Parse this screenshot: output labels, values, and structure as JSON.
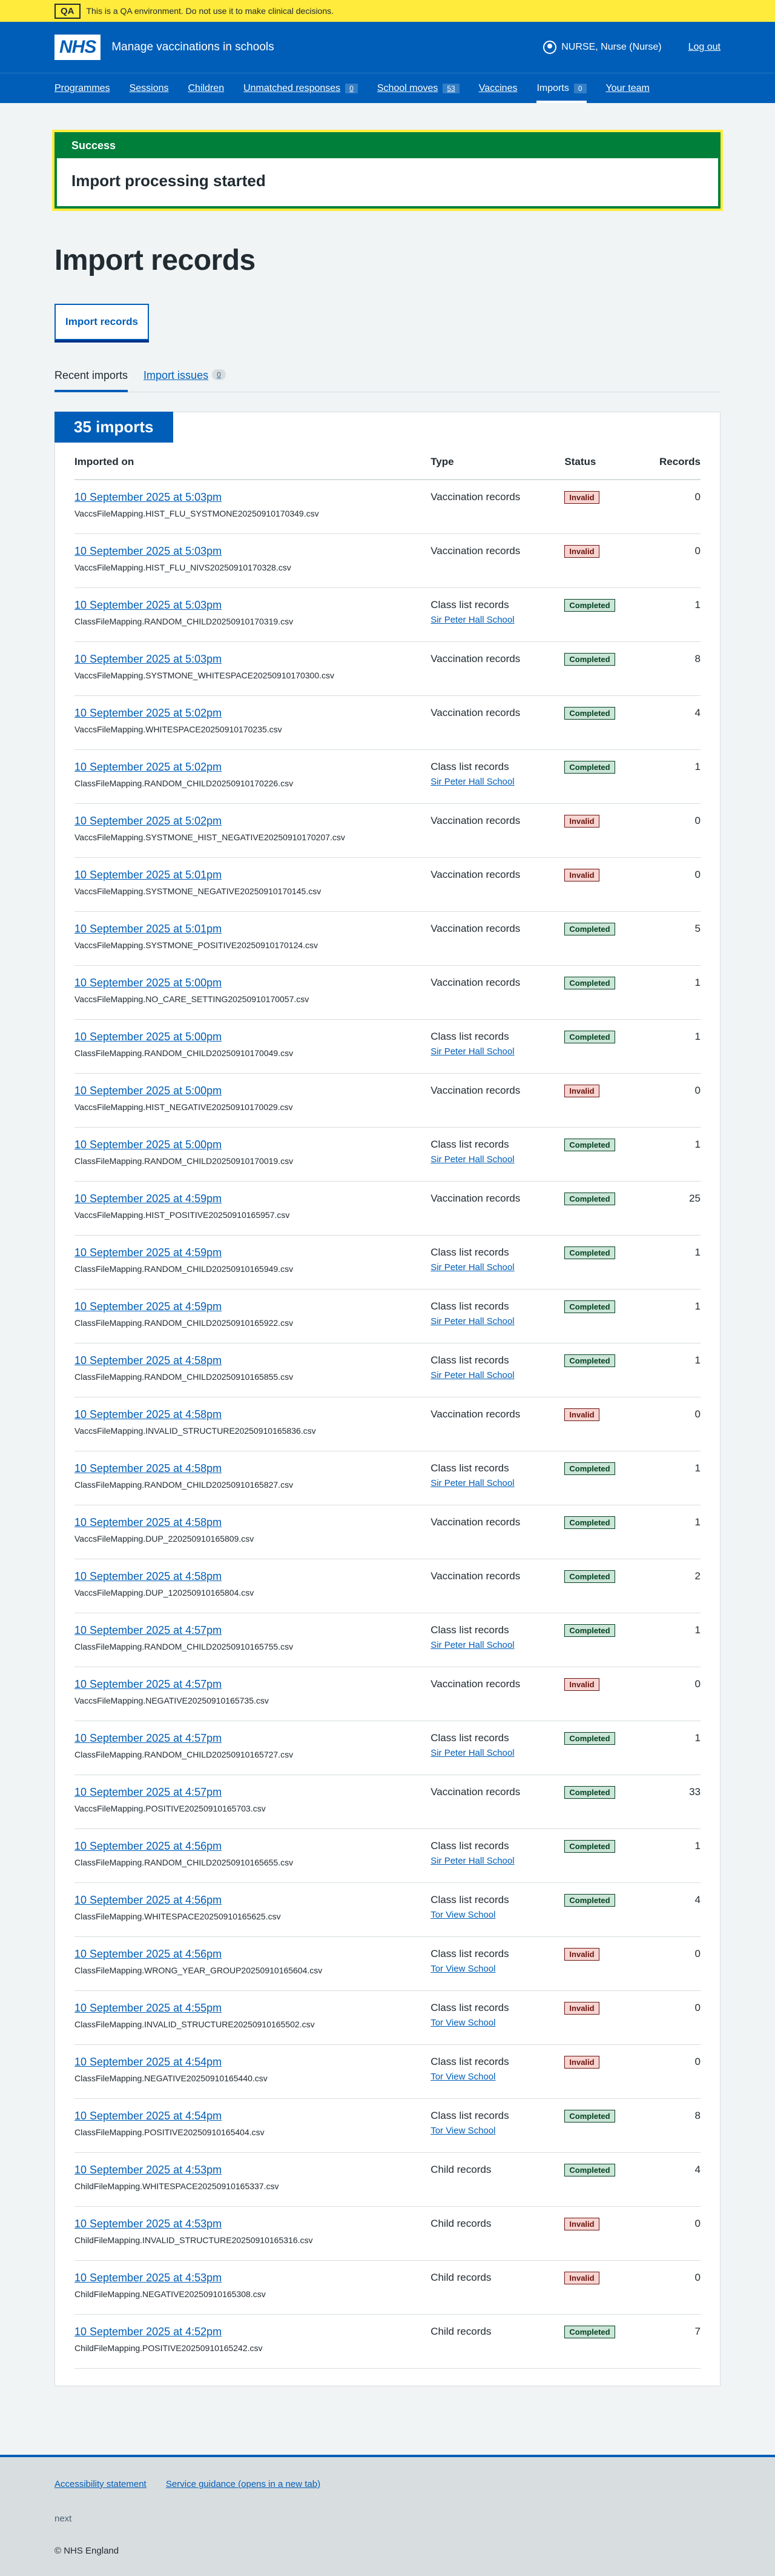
{
  "env": {
    "tag": "QA",
    "message": "This is a QA environment. Do not use it to make clinical decisions."
  },
  "header": {
    "logo": "NHS",
    "service": "Manage vaccinations in schools",
    "user": "NURSE, Nurse (Nurse)",
    "logout": "Log out",
    "nav": [
      {
        "label": "Programmes"
      },
      {
        "label": "Sessions"
      },
      {
        "label": "Children"
      },
      {
        "label": "Unmatched responses",
        "count": "0"
      },
      {
        "label": "School moves",
        "count": "53"
      },
      {
        "label": "Vaccines"
      },
      {
        "label": "Imports",
        "count": "0",
        "active": true
      },
      {
        "label": "Your team"
      }
    ]
  },
  "banner": {
    "title": "Success",
    "message": "Import processing started"
  },
  "page": {
    "title": "Import records",
    "button": "Import records"
  },
  "tabs": {
    "recent": "Recent imports",
    "issues": "Import issues",
    "issues_count": "0"
  },
  "table": {
    "heading": "35 imports",
    "columns": {
      "imported_on": "Imported on",
      "type": "Type",
      "status": "Status",
      "records": "Records"
    },
    "rows": [
      {
        "date": "10 September 2025 at 5:03pm",
        "file": "VaccsFileMapping.HIST_FLU_SYSTMONE20250910170349.csv",
        "type": "Vaccination records",
        "school": "",
        "status": "Invalid",
        "records": "0"
      },
      {
        "date": "10 September 2025 at 5:03pm",
        "file": "VaccsFileMapping.HIST_FLU_NIVS20250910170328.csv",
        "type": "Vaccination records",
        "school": "",
        "status": "Invalid",
        "records": "0"
      },
      {
        "date": "10 September 2025 at 5:03pm",
        "file": "ClassFileMapping.RANDOM_CHILD20250910170319.csv",
        "type": "Class list records",
        "school": "Sir Peter Hall School",
        "status": "Completed",
        "records": "1"
      },
      {
        "date": "10 September 2025 at 5:03pm",
        "file": "VaccsFileMapping.SYSTMONE_WHITESPACE20250910170300.csv",
        "type": "Vaccination records",
        "school": "",
        "status": "Completed",
        "records": "8"
      },
      {
        "date": "10 September 2025 at 5:02pm",
        "file": "VaccsFileMapping.WHITESPACE20250910170235.csv",
        "type": "Vaccination records",
        "school": "",
        "status": "Completed",
        "records": "4"
      },
      {
        "date": "10 September 2025 at 5:02pm",
        "file": "ClassFileMapping.RANDOM_CHILD20250910170226.csv",
        "type": "Class list records",
        "school": "Sir Peter Hall School",
        "status": "Completed",
        "records": "1"
      },
      {
        "date": "10 September 2025 at 5:02pm",
        "file": "VaccsFileMapping.SYSTMONE_HIST_NEGATIVE20250910170207.csv",
        "type": "Vaccination records",
        "school": "",
        "status": "Invalid",
        "records": "0"
      },
      {
        "date": "10 September 2025 at 5:01pm",
        "file": "VaccsFileMapping.SYSTMONE_NEGATIVE20250910170145.csv",
        "type": "Vaccination records",
        "school": "",
        "status": "Invalid",
        "records": "0"
      },
      {
        "date": "10 September 2025 at 5:01pm",
        "file": "VaccsFileMapping.SYSTMONE_POSITIVE20250910170124.csv",
        "type": "Vaccination records",
        "school": "",
        "status": "Completed",
        "records": "5"
      },
      {
        "date": "10 September 2025 at 5:00pm",
        "file": "VaccsFileMapping.NO_CARE_SETTING20250910170057.csv",
        "type": "Vaccination records",
        "school": "",
        "status": "Completed",
        "records": "1"
      },
      {
        "date": "10 September 2025 at 5:00pm",
        "file": "ClassFileMapping.RANDOM_CHILD20250910170049.csv",
        "type": "Class list records",
        "school": "Sir Peter Hall School",
        "status": "Completed",
        "records": "1"
      },
      {
        "date": "10 September 2025 at 5:00pm",
        "file": "VaccsFileMapping.HIST_NEGATIVE20250910170029.csv",
        "type": "Vaccination records",
        "school": "",
        "status": "Invalid",
        "records": "0"
      },
      {
        "date": "10 September 2025 at 5:00pm",
        "file": "ClassFileMapping.RANDOM_CHILD20250910170019.csv",
        "type": "Class list records",
        "school": "Sir Peter Hall School",
        "status": "Completed",
        "records": "1"
      },
      {
        "date": "10 September 2025 at 4:59pm",
        "file": "VaccsFileMapping.HIST_POSITIVE20250910165957.csv",
        "type": "Vaccination records",
        "school": "",
        "status": "Completed",
        "records": "25"
      },
      {
        "date": "10 September 2025 at 4:59pm",
        "file": "ClassFileMapping.RANDOM_CHILD20250910165949.csv",
        "type": "Class list records",
        "school": "Sir Peter Hall School",
        "status": "Completed",
        "records": "1"
      },
      {
        "date": "10 September 2025 at 4:59pm",
        "file": "ClassFileMapping.RANDOM_CHILD20250910165922.csv",
        "type": "Class list records",
        "school": "Sir Peter Hall School",
        "status": "Completed",
        "records": "1"
      },
      {
        "date": "10 September 2025 at 4:58pm",
        "file": "ClassFileMapping.RANDOM_CHILD20250910165855.csv",
        "type": "Class list records",
        "school": "Sir Peter Hall School",
        "status": "Completed",
        "records": "1"
      },
      {
        "date": "10 September 2025 at 4:58pm",
        "file": "VaccsFileMapping.INVALID_STRUCTURE20250910165836.csv",
        "type": "Vaccination records",
        "school": "",
        "status": "Invalid",
        "records": "0"
      },
      {
        "date": "10 September 2025 at 4:58pm",
        "file": "ClassFileMapping.RANDOM_CHILD20250910165827.csv",
        "type": "Class list records",
        "school": "Sir Peter Hall School",
        "status": "Completed",
        "records": "1"
      },
      {
        "date": "10 September 2025 at 4:58pm",
        "file": "VaccsFileMapping.DUP_220250910165809.csv",
        "type": "Vaccination records",
        "school": "",
        "status": "Completed",
        "records": "1"
      },
      {
        "date": "10 September 2025 at 4:58pm",
        "file": "VaccsFileMapping.DUP_120250910165804.csv",
        "type": "Vaccination records",
        "school": "",
        "status": "Completed",
        "records": "2"
      },
      {
        "date": "10 September 2025 at 4:57pm",
        "file": "ClassFileMapping.RANDOM_CHILD20250910165755.csv",
        "type": "Class list records",
        "school": "Sir Peter Hall School",
        "status": "Completed",
        "records": "1"
      },
      {
        "date": "10 September 2025 at 4:57pm",
        "file": "VaccsFileMapping.NEGATIVE20250910165735.csv",
        "type": "Vaccination records",
        "school": "",
        "status": "Invalid",
        "records": "0"
      },
      {
        "date": "10 September 2025 at 4:57pm",
        "file": "ClassFileMapping.RANDOM_CHILD20250910165727.csv",
        "type": "Class list records",
        "school": "Sir Peter Hall School",
        "status": "Completed",
        "records": "1"
      },
      {
        "date": "10 September 2025 at 4:57pm",
        "file": "VaccsFileMapping.POSITIVE20250910165703.csv",
        "type": "Vaccination records",
        "school": "",
        "status": "Completed",
        "records": "33"
      },
      {
        "date": "10 September 2025 at 4:56pm",
        "file": "ClassFileMapping.RANDOM_CHILD20250910165655.csv",
        "type": "Class list records",
        "school": "Sir Peter Hall School",
        "status": "Completed",
        "records": "1"
      },
      {
        "date": "10 September 2025 at 4:56pm",
        "file": "ClassFileMapping.WHITESPACE20250910165625.csv",
        "type": "Class list records",
        "school": "Tor View School",
        "status": "Completed",
        "records": "4"
      },
      {
        "date": "10 September 2025 at 4:56pm",
        "file": "ClassFileMapping.WRONG_YEAR_GROUP20250910165604.csv",
        "type": "Class list records",
        "school": "Tor View School",
        "status": "Invalid",
        "records": "0"
      },
      {
        "date": "10 September 2025 at 4:55pm",
        "file": "ClassFileMapping.INVALID_STRUCTURE20250910165502.csv",
        "type": "Class list records",
        "school": "Tor View School",
        "status": "Invalid",
        "records": "0"
      },
      {
        "date": "10 September 2025 at 4:54pm",
        "file": "ClassFileMapping.NEGATIVE20250910165440.csv",
        "type": "Class list records",
        "school": "Tor View School",
        "status": "Invalid",
        "records": "0"
      },
      {
        "date": "10 September 2025 at 4:54pm",
        "file": "ClassFileMapping.POSITIVE20250910165404.csv",
        "type": "Class list records",
        "school": "Tor View School",
        "status": "Completed",
        "records": "8"
      },
      {
        "date": "10 September 2025 at 4:53pm",
        "file": "ChildFileMapping.WHITESPACE20250910165337.csv",
        "type": "Child records",
        "school": "",
        "status": "Completed",
        "records": "4"
      },
      {
        "date": "10 September 2025 at 4:53pm",
        "file": "ChildFileMapping.INVALID_STRUCTURE20250910165316.csv",
        "type": "Child records",
        "school": "",
        "status": "Invalid",
        "records": "0"
      },
      {
        "date": "10 September 2025 at 4:53pm",
        "file": "ChildFileMapping.NEGATIVE20250910165308.csv",
        "type": "Child records",
        "school": "",
        "status": "Invalid",
        "records": "0"
      },
      {
        "date": "10 September 2025 at 4:52pm",
        "file": "ChildFileMapping.POSITIVE20250910165242.csv",
        "type": "Child records",
        "school": "",
        "status": "Completed",
        "records": "7"
      }
    ]
  },
  "footer": {
    "links": [
      "Accessibility statement",
      "Service guidance (opens in a new tab)"
    ],
    "version": "next",
    "copyright": "© NHS England"
  }
}
